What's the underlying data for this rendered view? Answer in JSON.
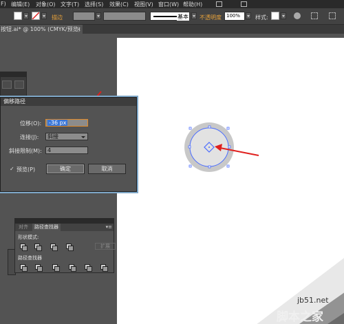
{
  "menubar": {
    "items": [
      "F)",
      "编辑(E)",
      "对象(O)",
      "文字(T)",
      "选择(S)",
      "效果(C)",
      "视图(V)",
      "窗口(W)",
      "帮助(H)"
    ]
  },
  "controlbar": {
    "stroke_label": "描边",
    "stroke_style": "基本",
    "opacity_label": "不透明度",
    "opacity_value": "100%",
    "style_label": "样式:"
  },
  "document_tab": {
    "title": "按钮.ai* @ 100% (CMYK/预览)",
    "close": "×"
  },
  "dialog": {
    "title": "偏移路径",
    "offset_label": "位移(O):",
    "offset_value": "-36 px",
    "join_label": "连接(J):",
    "join_value": "斜接",
    "miter_label": "斜接限制(M):",
    "miter_value": "4",
    "preview_check": "✓",
    "preview_label": "预览(P)",
    "ok_label": "确定",
    "cancel_label": "取消"
  },
  "pathfinder": {
    "tab_align": "对齐",
    "tab_pathfinder": "路径查找器",
    "menu": "▾≡",
    "shape_modes_label": "形状模式:",
    "pathfinders_label": "路径查找器",
    "expand_label": "扩展"
  },
  "watermark": {
    "url": "jb51.net",
    "text": "脚本之家"
  },
  "colors": {
    "accent_selection": "#3875d7",
    "annotation_arrow": "#e0201e",
    "path_selection": "#4a6cff"
  }
}
